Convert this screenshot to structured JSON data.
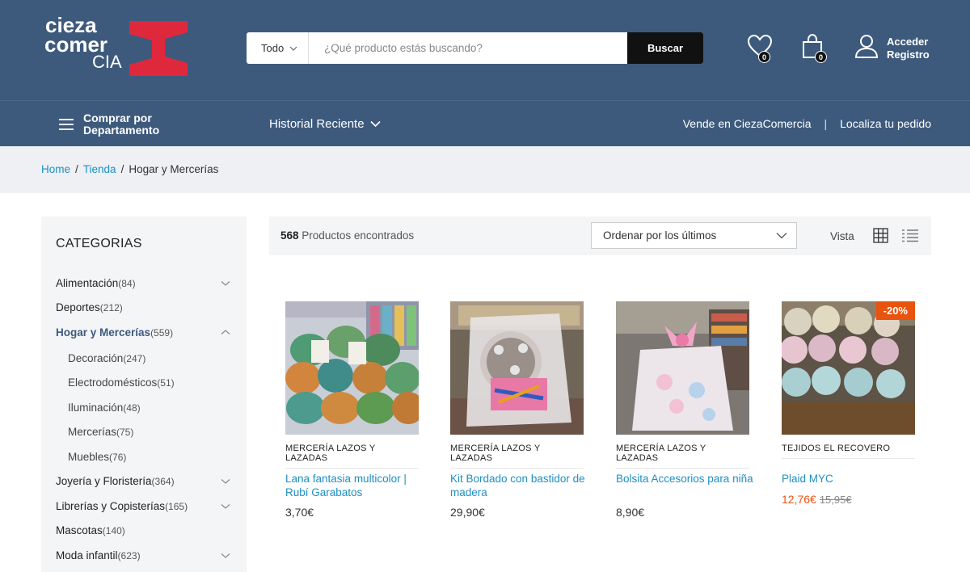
{
  "header": {
    "logo_line1": "cieza",
    "logo_line2": "comer",
    "logo_line3": "CIA",
    "search_category": "Todo",
    "search_placeholder": "¿Qué producto estás buscando?",
    "search_button": "Buscar",
    "wishlist_count": "0",
    "cart_count": "0",
    "account_line1": "Acceder",
    "account_line2": "Registro"
  },
  "nav": {
    "departments_label": "Comprar por Departamento",
    "recent_label": "Historial Reciente",
    "sell_link": "Vende en CiezaComercia",
    "separator": "|",
    "track_link": "Localiza tu pedido"
  },
  "breadcrumb": {
    "home": "Home",
    "shop": "Tienda",
    "current": "Hogar y Mercerías",
    "sep": "/"
  },
  "sidebar": {
    "title": "CATEGORIAS",
    "items": [
      {
        "label": "Alimentación",
        "count": "(84)"
      },
      {
        "label": "Deportes",
        "count": "(212)"
      },
      {
        "label": "Hogar y Mercerías",
        "count": "(559)"
      },
      {
        "label": "Decoración",
        "count": "(247)"
      },
      {
        "label": "Electrodomésticos",
        "count": "(51)"
      },
      {
        "label": "Iluminación",
        "count": "(48)"
      },
      {
        "label": "Mercerías",
        "count": "(75)"
      },
      {
        "label": "Muebles",
        "count": "(76)"
      },
      {
        "label": "Joyería y Floristería",
        "count": "(364)"
      },
      {
        "label": "Librerías y Copisterías",
        "count": "(165)"
      },
      {
        "label": "Mascotas",
        "count": "(140)"
      },
      {
        "label": "Moda infantil",
        "count": "(623)"
      }
    ]
  },
  "toolbar": {
    "found_count": "568",
    "found_label": "Productos encontrados",
    "sort_selected": "Ordenar por los últimos",
    "view_label": "Vista"
  },
  "products": [
    {
      "category": "MERCERÍA LAZOS Y LAZADAS",
      "name": "Lana fantasia multicolor | Rubí Garabatos",
      "price": "3,70€"
    },
    {
      "category": "MERCERÍA LAZOS Y LAZADAS",
      "name": "Kit Bordado con bastidor de madera",
      "price": "29,90€"
    },
    {
      "category": "MERCERÍA LAZOS Y LAZADAS",
      "name": "Bolsita Accesorios para niña",
      "price": "8,90€"
    },
    {
      "category": "TEJIDOS EL RECOVERO",
      "name": "Plaid MYC",
      "price": "12,76€",
      "old_price": "15,95€",
      "discount": "-20%"
    }
  ],
  "colors": {
    "header_bg": "#3d5a7d",
    "link": "#1e8fc5",
    "sale": "#e8530e",
    "logo_red": "#e0283c"
  }
}
